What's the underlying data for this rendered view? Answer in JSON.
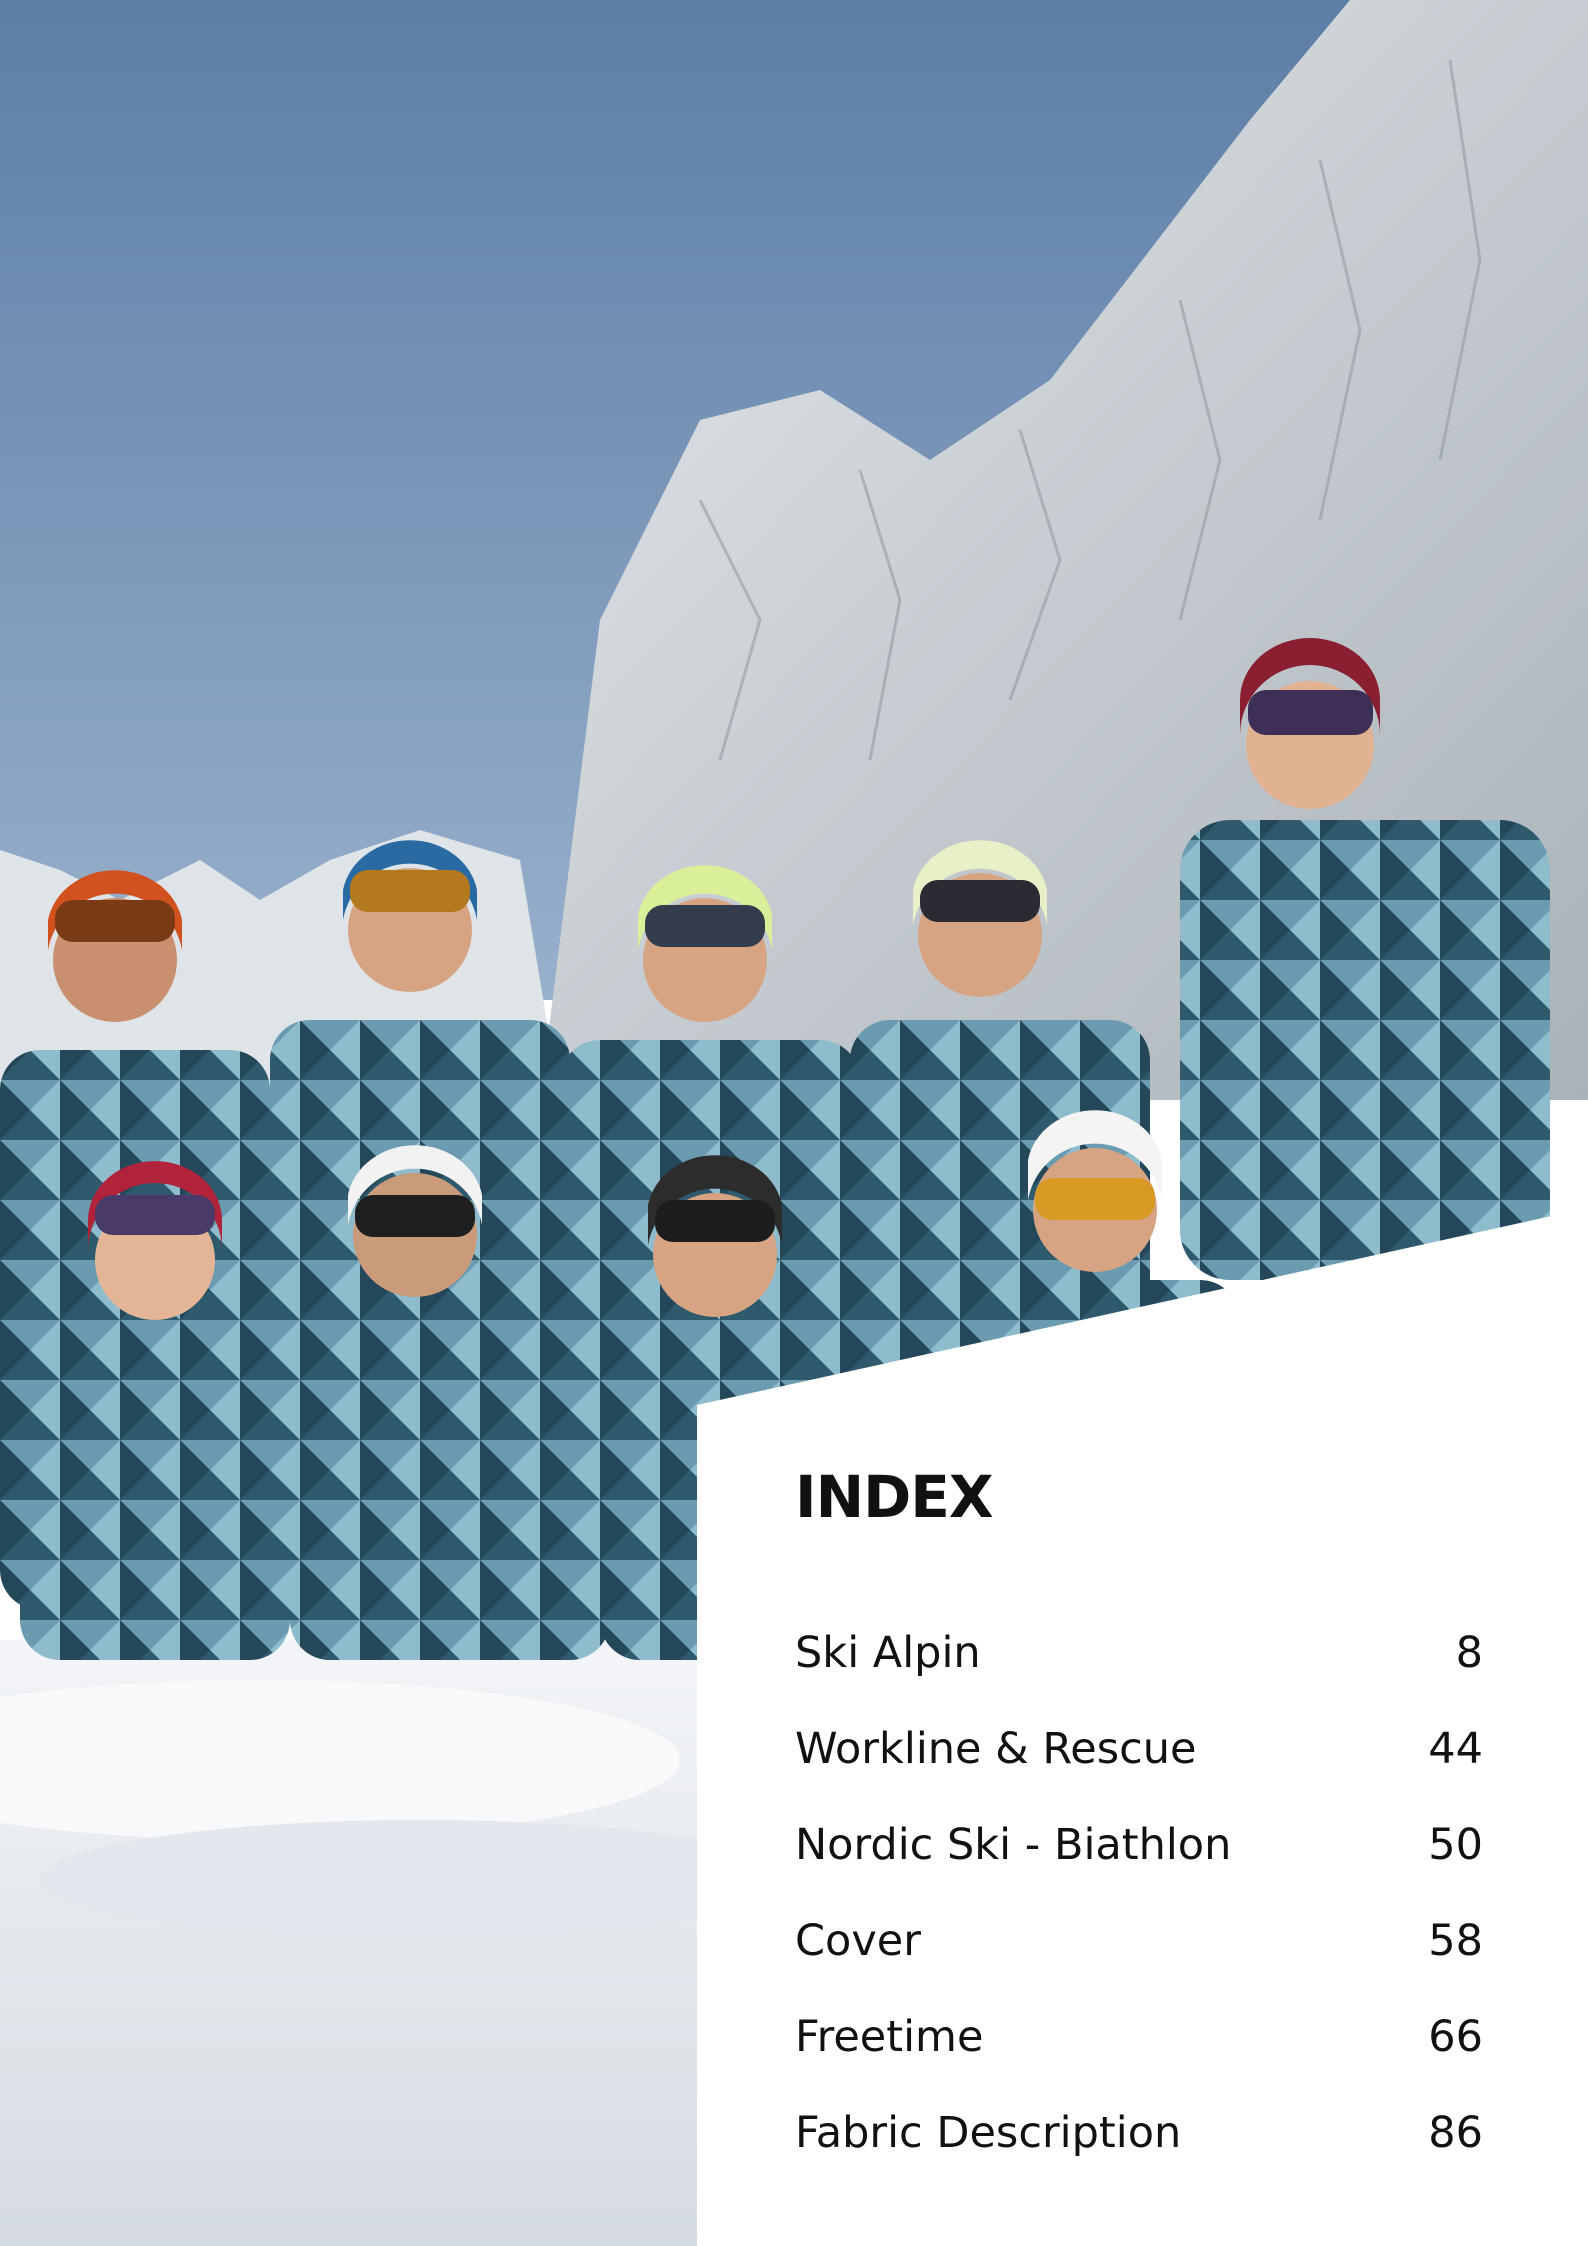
{
  "index": {
    "title": "INDEX",
    "entries": [
      {
        "label": "Ski Alpin",
        "page": "8"
      },
      {
        "label": "Workline & Rescue",
        "page": "44"
      },
      {
        "label": "Nordic Ski - Biathlon",
        "page": "50"
      },
      {
        "label": "Cover",
        "page": "58"
      },
      {
        "label": "Freetime",
        "page": "66"
      },
      {
        "label": "Fabric Description",
        "page": "86"
      }
    ]
  },
  "colors": {
    "sky_top": "#5f7fa6",
    "sky_bottom": "#8eaac8",
    "rock": "#d8dde1",
    "snow": "#eef2f6",
    "jacket": "#3f6f86",
    "panel": "#ffffff",
    "text": "#111111"
  }
}
